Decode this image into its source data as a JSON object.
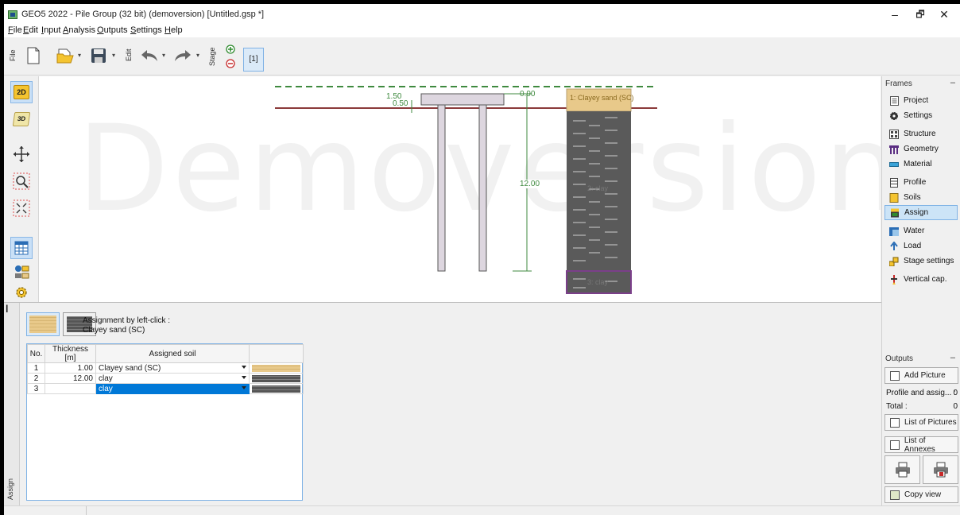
{
  "window": {
    "title": "GEO5 2022 - Pile Group (32 bit) (demoversion) [Untitled.gsp *]",
    "minimize": "–",
    "restore": "🗗",
    "close": "✕"
  },
  "menu": {
    "items": [
      "File",
      "Edit",
      "Input",
      "Analysis",
      "Outputs",
      "Settings",
      "Help"
    ]
  },
  "toolbar": {
    "file_label": "File",
    "edit_label": "Edit",
    "stage_label": "Stage",
    "stage_value": "[1]",
    "icons": [
      "new-file-icon",
      "open-folder-icon",
      "save-icon",
      "undo-icon",
      "redo-icon",
      "add-stage-icon",
      "remove-stage-icon"
    ]
  },
  "left_tools": {
    "items": [
      "2D",
      "3D",
      "move-icon",
      "zoom-icon",
      "fit-view-icon",
      "table-icon",
      "soil-legend-icon",
      "settings-icon"
    ]
  },
  "canvas": {
    "watermark": "Demoversion",
    "dims": {
      "width": "1.50",
      "cap": "0.50",
      "top": "0.90",
      "length": "12.00"
    },
    "soil_layer_1": "1: Clayey sand (SC)",
    "soil_layer_2": "2: clay",
    "soil_layer_3": "3: clay"
  },
  "frames": {
    "header": "Frames",
    "items": [
      {
        "label": "Project",
        "icon": "project-icon"
      },
      {
        "label": "Settings",
        "icon": "settings-icon"
      },
      {
        "label": "Structure",
        "icon": "structure-icon"
      },
      {
        "label": "Geometry",
        "icon": "geometry-icon"
      },
      {
        "label": "Material",
        "icon": "material-icon"
      },
      {
        "label": "Profile",
        "icon": "profile-icon"
      },
      {
        "label": "Soils",
        "icon": "soils-icon"
      },
      {
        "label": "Assign",
        "icon": "assign-icon"
      },
      {
        "label": "Water",
        "icon": "water-icon"
      },
      {
        "label": "Load",
        "icon": "load-icon"
      },
      {
        "label": "Stage settings",
        "icon": "stage-settings-icon"
      },
      {
        "label": "Vertical cap.",
        "icon": "vertical-cap-icon"
      }
    ],
    "active": "Assign"
  },
  "outputs": {
    "header": "Outputs",
    "add_picture": "Add Picture",
    "profile_label": "Profile and assig... :",
    "profile_value": "0",
    "total_label": "Total :",
    "total_value": "0",
    "list_pictures": "List of Pictures",
    "list_annexes": "List of Annexes",
    "copy_view": "Copy view"
  },
  "assign_panel": {
    "side_label": "Assign",
    "assignment_title": "Assignment by left-click :",
    "assignment_soil": "Clayey sand (SC)",
    "columns": [
      "No.",
      "Thickness [m]",
      "Assigned soil",
      ""
    ],
    "rows": [
      {
        "no": "1",
        "thickness": "1.00",
        "soil": "Clayey sand (SC)",
        "pattern": "sand"
      },
      {
        "no": "2",
        "thickness": "12.00",
        "soil": "clay",
        "pattern": "clay"
      },
      {
        "no": "3",
        "thickness": "",
        "soil": "clay",
        "pattern": "clay"
      }
    ]
  },
  "colors": {
    "sand": "#e8c98a",
    "clay": "#555555",
    "water_line": "#3f8a3f",
    "terrain_line": "#8b3a3a",
    "selection": "#0078d7"
  }
}
